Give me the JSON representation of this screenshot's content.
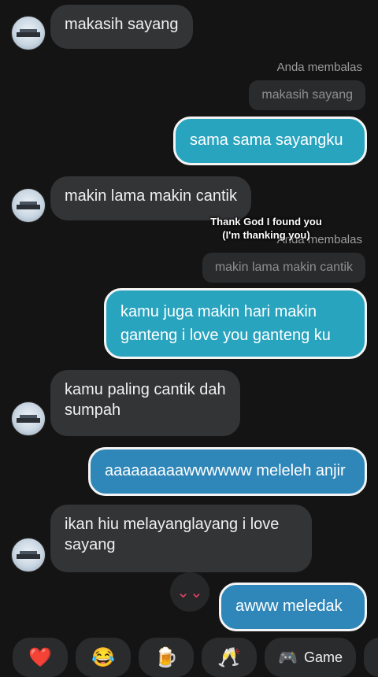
{
  "messages": [
    {
      "text": "makasih sayang"
    },
    {
      "reply_label": "Anda membalas",
      "quote": "makasih sayang",
      "text": "sama sama sayangku"
    },
    {
      "text": "makin lama makin cantik"
    },
    {
      "reply_label": "Anda membalas",
      "quote": "makin lama makin cantik",
      "line1": "kamu juga makin hari makin",
      "line2": "ganteng i love you ganteng ku"
    },
    {
      "line1": "kamu paling cantik dah",
      "line2": "sumpah"
    },
    {
      "text": "aaaaaaaaawwwwww meleleh anjir"
    },
    {
      "line1": "ikan hiu melayanglayang i love",
      "line2": "sayang"
    },
    {
      "text": "awww meledak"
    }
  ],
  "overlay_caption": {
    "line1": "Thank God I found you",
    "line2": "(I'm thanking you)"
  },
  "scroll_icon": "⌄⌄",
  "quick_actions": {
    "heart": "❤️",
    "laugh": "😂",
    "beer": "🍺",
    "cheers": "🥂",
    "game_icon": "🎮",
    "game_label": "Game"
  }
}
